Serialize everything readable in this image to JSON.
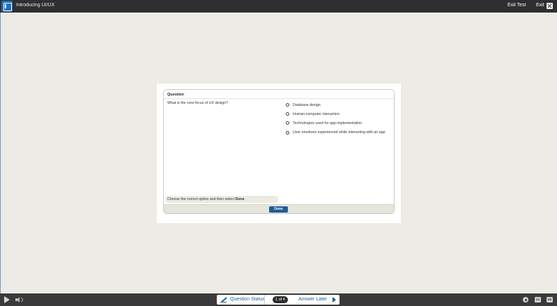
{
  "header": {
    "title": "Introducing UI/UX",
    "exit_test_label": "Exit Test",
    "exit_label": "Exit",
    "icons": {
      "app": "panel-toggle-icon",
      "close": "close-icon"
    }
  },
  "question": {
    "heading": "Question",
    "text": "What is the core focus of UX design?",
    "options": [
      {
        "label": "Database design",
        "selected": false
      },
      {
        "label": "Human-computer interaction",
        "selected": false
      },
      {
        "label": "Technologies used for app implementation",
        "selected": false
      },
      {
        "label": "User emotions experienced while interacting with an app",
        "selected": false
      }
    ],
    "instruction_prefix": "Choose the correct option and then select ",
    "instruction_bold": "Done",
    "instruction_suffix": ".",
    "done_label": "Done"
  },
  "footer": {
    "question_status_label": "Question Status",
    "counter": "1 of 4",
    "answer_later_label": "Answer Later",
    "cc_label": "CC",
    "grid_label": "EB"
  },
  "colors": {
    "topbar": "#2f2f2f",
    "accent": "#1f5d94",
    "background": "#ecebe5"
  }
}
